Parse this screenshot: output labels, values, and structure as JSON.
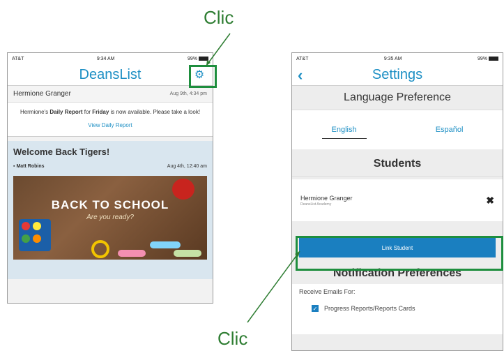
{
  "annotations": {
    "top_label": "Clic",
    "bottom_label": "Clic"
  },
  "phone1": {
    "status": {
      "carrier": "AT&T",
      "time": "9:34 AM",
      "battery": "99%"
    },
    "nav_title": "DeansList",
    "notification": {
      "name": "Hermione Granger",
      "time": "Aug 9th, 4:34 pm",
      "text_pre": "Hermione's ",
      "text_bold1": "Daily Report",
      "text_mid": " for ",
      "text_bold2": "Friday",
      "text_post": " is now available. Please take a look!",
      "link": "View Daily Report"
    },
    "post": {
      "title": "Welcome Back Tigers!",
      "author": "Matt Robins",
      "time": "Aug 4th, 12:40 am",
      "image_title": "BACK TO SCHOOL",
      "image_subtitle": "Are you ready?"
    }
  },
  "phone2": {
    "status": {
      "carrier": "AT&T",
      "time": "9:35 AM",
      "battery": "99%"
    },
    "nav_title": "Settings",
    "language_header": "Language Preference",
    "languages": [
      "English",
      "Español"
    ],
    "students_header": "Students",
    "student": {
      "name": "Hermione Granger",
      "school": "DeansList Academy"
    },
    "link_button": "Link Student",
    "notifications_header": "Notification Preferences",
    "receive_label": "Receive Emails For:",
    "checkbox_label": "Progress Reports/Reports Cards"
  },
  "colors": {
    "accent": "#1d8fc4",
    "highlight": "#1e8e3e",
    "button": "#1a7fc0"
  }
}
